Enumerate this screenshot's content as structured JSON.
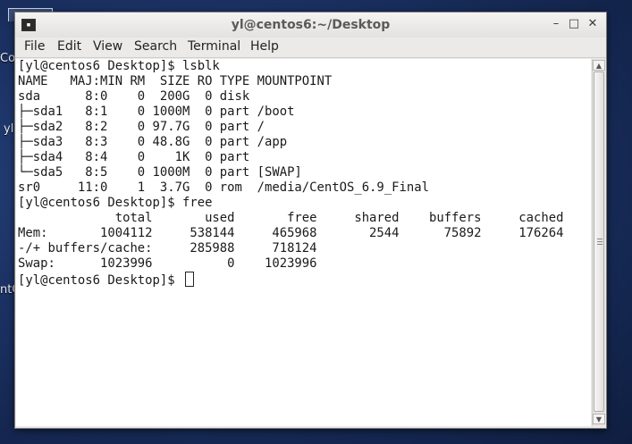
{
  "desktop": {
    "fragments": [
      "Co",
      "yl",
      "ntO"
    ]
  },
  "window": {
    "title": "yl@centos6:~/Desktop",
    "minimize_label": "–",
    "maximize_label": "□",
    "close_label": "✕",
    "terminal_icon": "terminal-icon"
  },
  "menu": {
    "items": [
      "File",
      "Edit",
      "View",
      "Search",
      "Terminal",
      "Help"
    ]
  },
  "terminal": {
    "lines": [
      "[yl@centos6 Desktop]$ lsblk",
      "NAME   MAJ:MIN RM  SIZE RO TYPE MOUNTPOINT",
      "sda      8:0    0  200G  0 disk",
      "├─sda1   8:1    0 1000M  0 part /boot",
      "├─sda2   8:2    0 97.7G  0 part /",
      "├─sda3   8:3    0 48.8G  0 part /app",
      "├─sda4   8:4    0    1K  0 part",
      "└─sda5   8:5    0 1000M  0 part [SWAP]",
      "sr0     11:0    1  3.7G  0 rom  /media/CentOS_6.9_Final",
      "[yl@centos6 Desktop]$ free",
      "             total       used       free     shared    buffers     cached",
      "Mem:       1004112     538144     465968       2544      75892     176264",
      "-/+ buffers/cache:     285988     718124",
      "Swap:      1023996          0    1023996"
    ],
    "prompt": "[yl@centos6 Desktop]$ "
  }
}
